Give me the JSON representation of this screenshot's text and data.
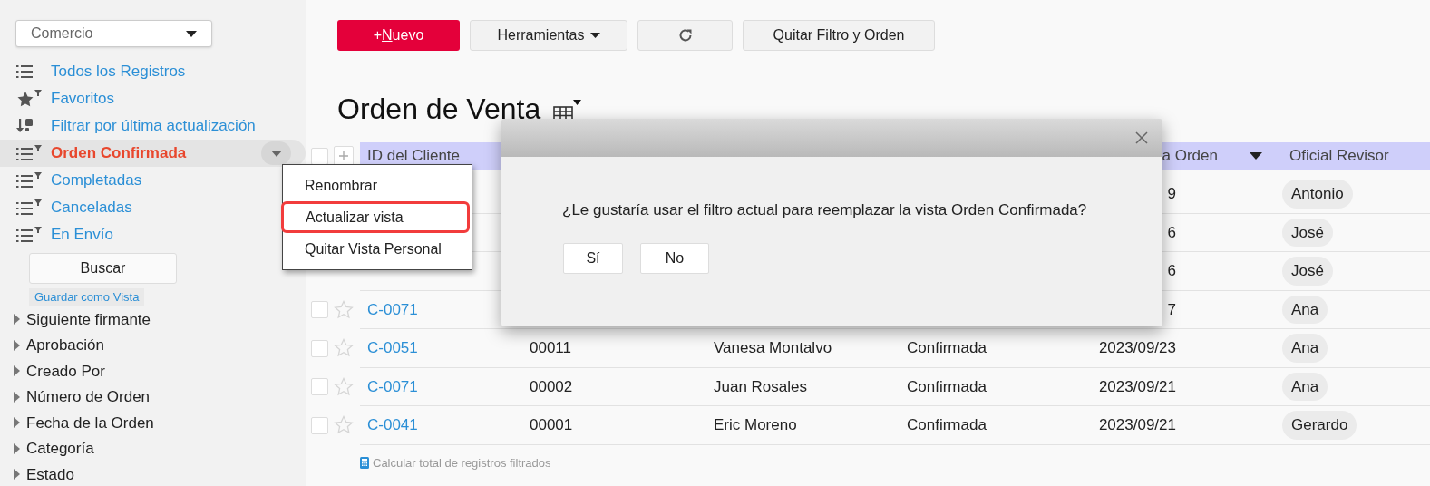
{
  "sidebar": {
    "app_selector": {
      "value": "Comercio"
    },
    "views": [
      {
        "kind": "all",
        "label": "Todos los Registros",
        "selected": false
      },
      {
        "kind": "favorites",
        "label": "Favoritos",
        "selected": false
      },
      {
        "kind": "recent",
        "label": "Filtrar por última actualización",
        "selected": false
      },
      {
        "kind": "custom",
        "label": "Orden Confirmada",
        "selected": true
      },
      {
        "kind": "custom",
        "label": "Completadas",
        "selected": false
      },
      {
        "kind": "custom",
        "label": "Canceladas",
        "selected": false
      },
      {
        "kind": "custom",
        "label": "En Envío",
        "selected": false
      }
    ],
    "search_button": "Buscar",
    "save_view_link": "Guardar como Vista",
    "filters": [
      {
        "label": "Siguiente firmante",
        "expanded": false
      },
      {
        "label": "Aprobación",
        "expanded": false
      },
      {
        "label": "Creado Por",
        "expanded": false
      },
      {
        "label": "Número de Orden",
        "expanded": false
      },
      {
        "label": "Fecha de la Orden",
        "expanded": false
      },
      {
        "label": "Categoría",
        "expanded": false
      },
      {
        "label": "Estado",
        "expanded": false
      }
    ]
  },
  "toolbar": {
    "buttons": [
      {
        "kind": "primary",
        "label": "+Nuevo"
      },
      {
        "kind": "menu",
        "label": "Herramientas"
      },
      {
        "kind": "refresh"
      },
      {
        "kind": "plain",
        "label": "Quitar Filtro y Orden"
      }
    ]
  },
  "page_title": "Orden de Venta",
  "table": {
    "select_all_checked": false,
    "columns": [
      {
        "label": "ID del Cliente",
        "sorted": false
      },
      {
        "label": "a Orden",
        "sorted": true
      },
      {
        "label": "Oficial Revisor",
        "sorted": false
      }
    ],
    "rows": [
      {
        "order_date": "9",
        "reviewer": "Antonio"
      },
      {
        "order_date": "6",
        "reviewer": "José"
      },
      {
        "order_date": "6",
        "reviewer": "José"
      },
      {
        "checked": false,
        "id": "C-0071",
        "order_date": "7",
        "reviewer": "Ana"
      },
      {
        "checked": false,
        "id": "C-0051",
        "order_number": "00011",
        "customer": "Vanesa Montalvo",
        "status": "Confirmada",
        "order_date": "2023/09/23",
        "reviewer": "Ana"
      },
      {
        "checked": false,
        "id": "C-0071",
        "order_number": "00002",
        "customer": "Juan Rosales",
        "status": "Confirmada",
        "order_date": "2023/09/21",
        "reviewer": "Ana"
      },
      {
        "checked": false,
        "id": "C-0041",
        "order_number": "00001",
        "customer": "Eric Moreno",
        "status": "Confirmada",
        "order_date": "2023/09/21",
        "reviewer": "Gerardo"
      }
    ],
    "footer_link": "Calcular total de registros filtrados"
  },
  "context_menu": {
    "items": [
      {
        "label": "Renombrar",
        "highlighted": false
      },
      {
        "label": "Actualizar vista",
        "highlighted": true
      },
      {
        "label": "Quitar Vista Personal",
        "highlighted": false
      }
    ]
  },
  "dialog": {
    "message": "¿Le gustaría usar el filtro actual para reemplazar la vista Orden Confirmada?",
    "buttons": [
      "Sí",
      "No"
    ]
  }
}
